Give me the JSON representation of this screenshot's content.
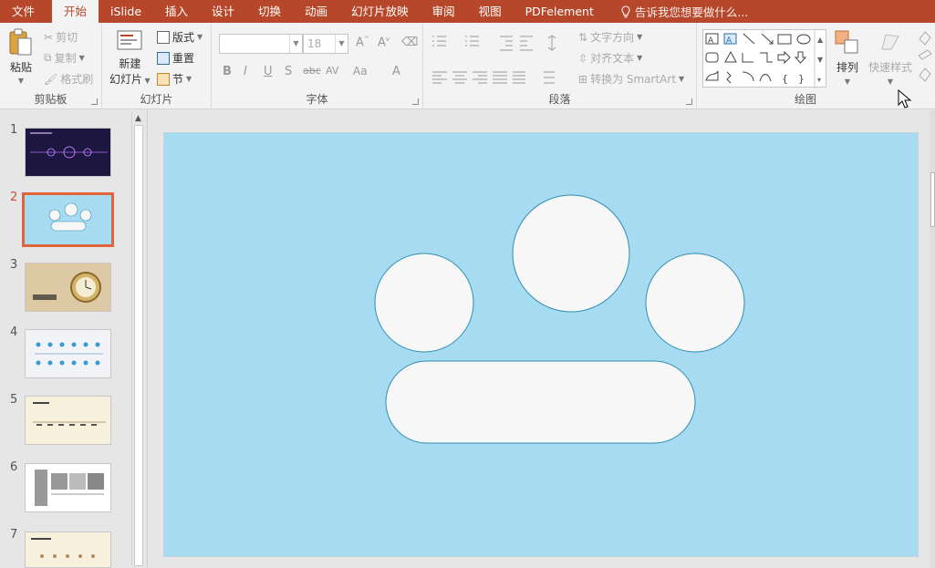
{
  "menubar": {
    "tabs": [
      {
        "label": "文件"
      },
      {
        "label": "开始"
      },
      {
        "label": "iSlide"
      },
      {
        "label": "插入"
      },
      {
        "label": "设计"
      },
      {
        "label": "切换"
      },
      {
        "label": "动画"
      },
      {
        "label": "幻灯片放映"
      },
      {
        "label": "审阅"
      },
      {
        "label": "视图"
      },
      {
        "label": "PDFelement"
      }
    ],
    "active_tab": "开始",
    "tell_me": "告诉我您想要做什么...",
    "accent_color": "#b7472a"
  },
  "ribbon": {
    "clipboard": {
      "paste": "粘贴",
      "cut": "剪切",
      "copy": "复制",
      "format_painter": "格式刷",
      "label": "剪贴板"
    },
    "slides": {
      "new_slide_line1": "新建",
      "new_slide_line2": "幻灯片",
      "layout": "版式",
      "reset": "重置",
      "section": "节",
      "label": "幻灯片"
    },
    "font": {
      "font_name": "",
      "font_size": "18",
      "label": "字体"
    },
    "paragraph": {
      "text_direction": "文字方向",
      "align_text": "对齐文本",
      "smartart": "转换为 SmartArt",
      "label": "段落"
    },
    "drawing": {
      "arrange": "排列",
      "quick_styles": "快速样式",
      "label": "绘图"
    }
  },
  "slides_panel": {
    "numbers": [
      "1",
      "2",
      "3",
      "4",
      "5",
      "6",
      "7"
    ],
    "selected": "2"
  },
  "slide": {
    "background": "#a7dbf2",
    "shape_fill": "#f7f7f7",
    "shape_stroke": "#2f8fb0"
  }
}
